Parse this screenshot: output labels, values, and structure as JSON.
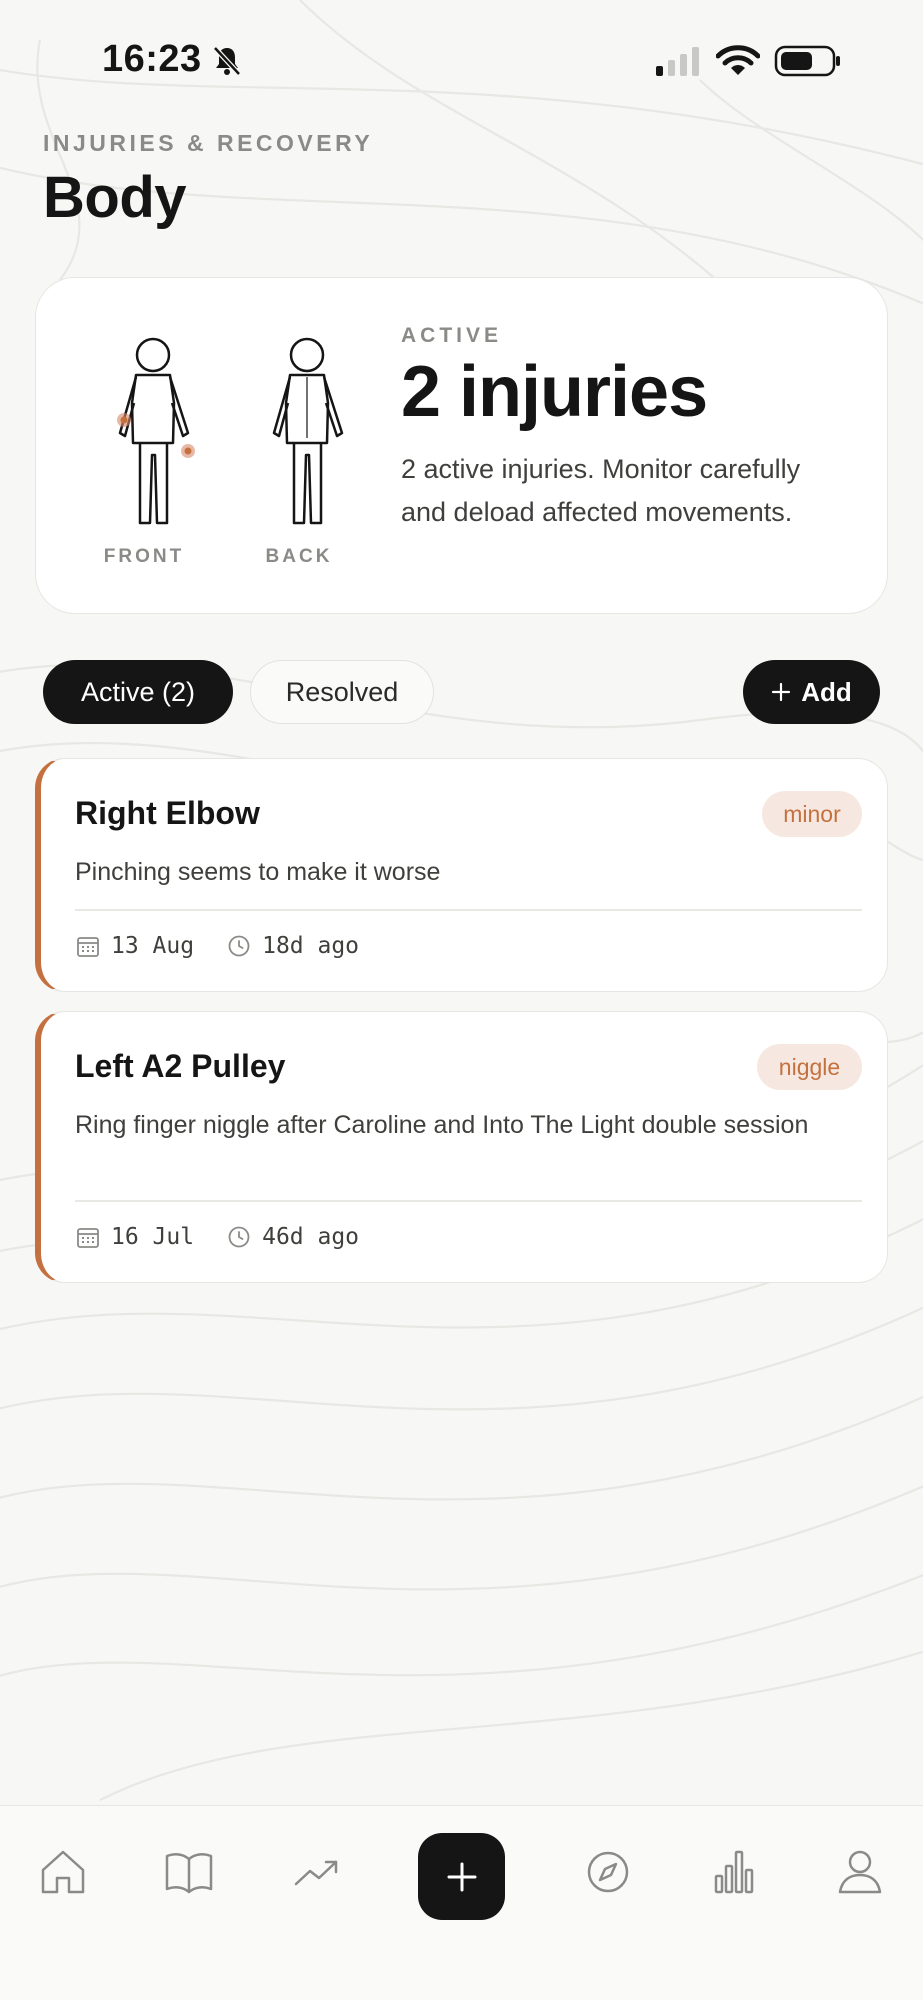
{
  "status_bar": {
    "time": "16:23",
    "icons": [
      "bell-off-icon",
      "signal-icon",
      "wifi-icon",
      "battery-icon"
    ]
  },
  "header": {
    "eyebrow": "INJURIES & RECOVERY",
    "title": "Body"
  },
  "summary": {
    "front_label": "FRONT",
    "back_label": "BACK",
    "eyebrow": "ACTIVE",
    "count": "2 injuries",
    "description": "2 active injuries. Monitor carefully and deload affected movements."
  },
  "filters": {
    "active_label": "Active (2)",
    "resolved_label": "Resolved",
    "add_label": "Add"
  },
  "injuries": [
    {
      "title": "Right Elbow",
      "severity": "minor",
      "description": "Pinching seems to make it worse",
      "date": "13 Aug",
      "ago": "18d ago"
    },
    {
      "title": "Left A2 Pulley",
      "severity": "niggle",
      "description": "Ring finger niggle after Caroline and Into The Light double session",
      "date": "16 Jul",
      "ago": "46d ago"
    }
  ],
  "nav": {
    "items": [
      "home-icon",
      "book-icon",
      "trend-icon",
      "add-icon",
      "compass-icon",
      "chart-icon",
      "profile-icon"
    ]
  },
  "colors": {
    "accent": "#c4713f",
    "badge_bg": "#f6e8e0",
    "dark": "#151515",
    "background": "#f7f7f5"
  }
}
